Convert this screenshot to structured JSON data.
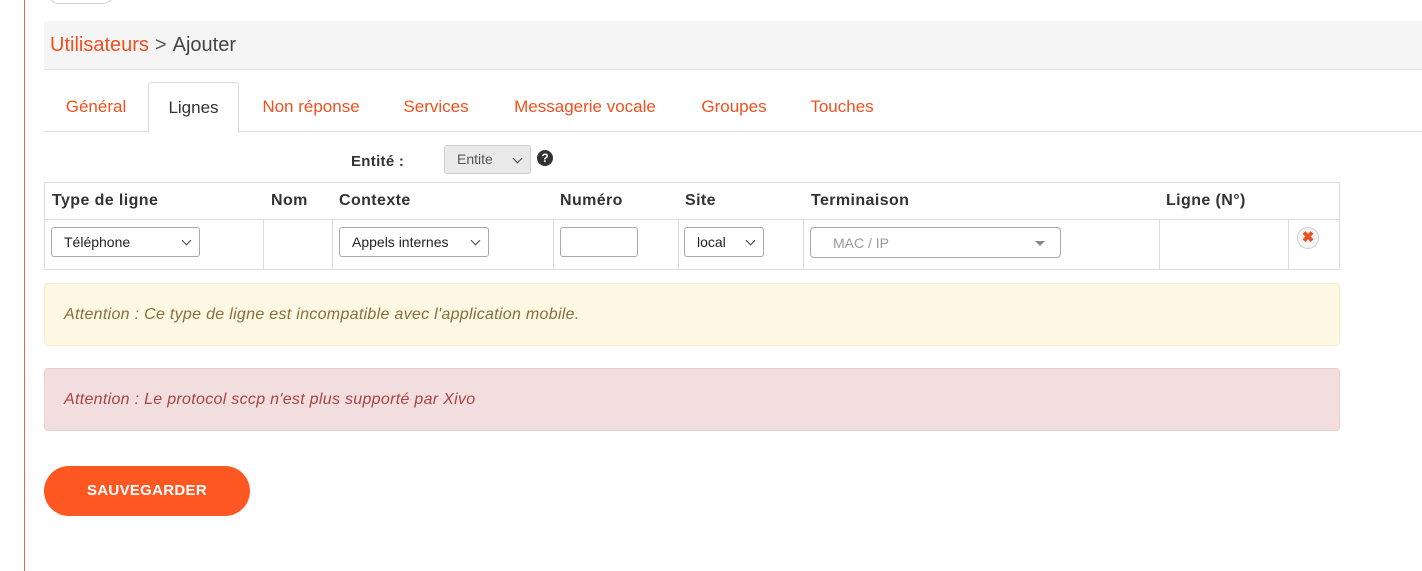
{
  "breadcrumb": {
    "parent": "Utilisateurs",
    "separator": ">",
    "current": "Ajouter"
  },
  "tabs": [
    {
      "label": "Général",
      "active": false
    },
    {
      "label": "Lignes",
      "active": true
    },
    {
      "label": "Non réponse",
      "active": false
    },
    {
      "label": "Services",
      "active": false
    },
    {
      "label": "Messagerie vocale",
      "active": false
    },
    {
      "label": "Groupes",
      "active": false
    },
    {
      "label": "Touches",
      "active": false
    }
  ],
  "entity": {
    "label": "Entité :",
    "selected": "Entite",
    "help_icon": "question-circle-icon"
  },
  "table": {
    "headers": {
      "type": "Type de ligne",
      "nom": "Nom",
      "contexte": "Contexte",
      "numero": "Numéro",
      "site": "Site",
      "terminaison": "Terminaison",
      "ligne": "Ligne (N°)"
    },
    "row": {
      "type": "Téléphone",
      "nom": "",
      "contexte": "Appels internes",
      "numero": "",
      "site": "local",
      "terminaison_placeholder": "MAC / IP",
      "ligne": "",
      "remove_icon": "remove-circle-icon"
    }
  },
  "alerts": {
    "warning": "Attention : Ce type de ligne est incompatible avec l'application mobile.",
    "danger": "Attention : Le protocol sccp n'est plus supporté par Xivo"
  },
  "save_label": "SAUVEGARDER",
  "colors": {
    "accent": "#f0501e",
    "button": "#ff5722",
    "warning_bg": "#fcf8e3",
    "danger_bg": "#f2dede"
  }
}
